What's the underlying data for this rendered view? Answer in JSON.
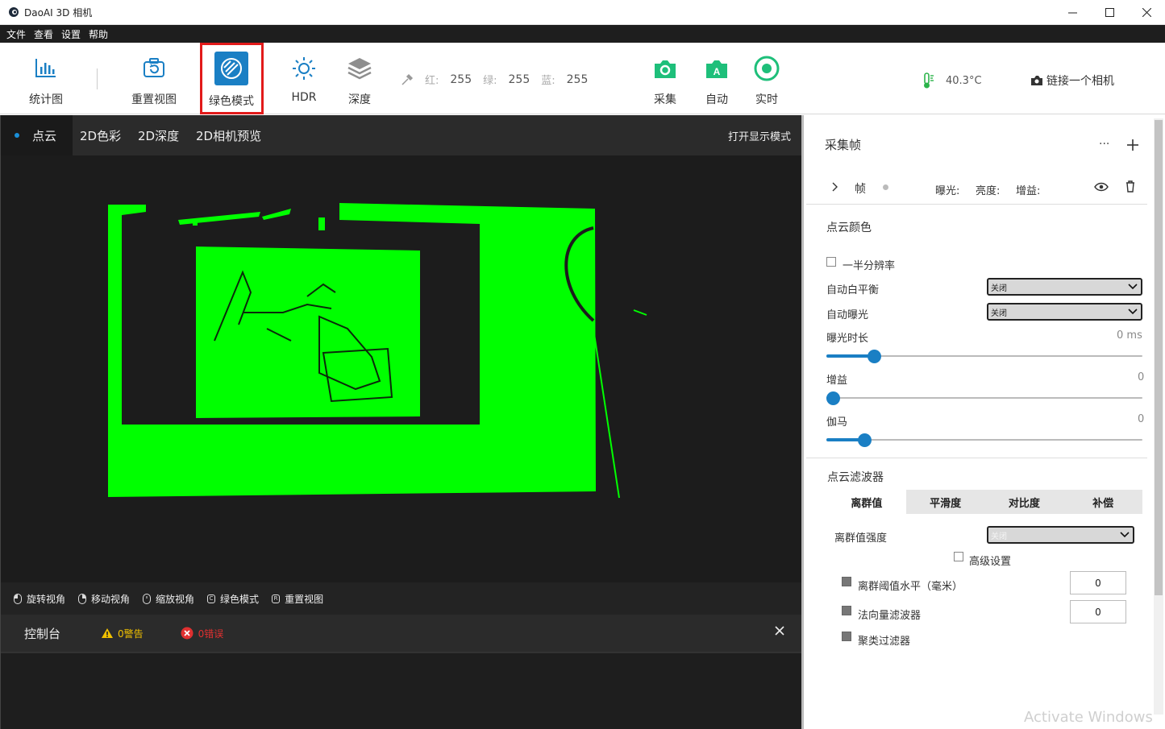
{
  "window": {
    "title": "DaoAI 3D 相机"
  },
  "menu": [
    "文件",
    "查看",
    "设置",
    "帮助"
  ],
  "toolbar": {
    "stats": "统计图",
    "reset_view": "重置视图",
    "green_mode": "绿色模式",
    "hdr": "HDR",
    "depth": "深度",
    "capture": "采集",
    "auto": "自动",
    "realtime": "实时",
    "rgb": {
      "r_label": "红:",
      "r": "255",
      "g_label": "绿:",
      "g": "255",
      "b_label": "蓝:",
      "b": "255"
    },
    "temperature": "40.3°C",
    "connect": "链接一个相机"
  },
  "viewer": {
    "tabs": [
      "点云",
      "2D色彩",
      "2D深度",
      "2D相机预览"
    ],
    "display_mode": "打开显示模式",
    "hints": [
      "旋转视角",
      "移动视角",
      "缩放视角",
      "绿色模式",
      "重置视图"
    ],
    "hint_keys": [
      "",
      "",
      "",
      "C",
      "R"
    ]
  },
  "console": {
    "title": "控制台",
    "warnings": "0警告",
    "errors": "0错误"
  },
  "panel": {
    "capture_frames": "采集帧",
    "more": "···",
    "frame": {
      "label": "帧",
      "exposure": "曝光:",
      "brightness": "亮度:",
      "gain": "增益:"
    },
    "pc_color": "点云颜色",
    "half_res": "一半分辨率",
    "auto_wb": {
      "label": "自动白平衡",
      "value": "关闭"
    },
    "auto_exp": {
      "label": "自动曝光",
      "value": "关闭"
    },
    "exposure_time": {
      "label": "曝光时长",
      "value": "0 ms",
      "level": 0.15
    },
    "gain": {
      "label": "增益",
      "value": "0",
      "level": 0.02
    },
    "gamma": {
      "label": "伽马",
      "value": "0",
      "level": 0.12
    },
    "filter_title": "点云滤波器",
    "filter_tabs": [
      "离群值",
      "平滑度",
      "对比度",
      "补偿"
    ],
    "outlier_strength": {
      "label": "离群值强度",
      "value": "关闭"
    },
    "advanced": "高级设置",
    "outlier_threshold": {
      "label": "离群阈值水平（毫米）",
      "value": "0"
    },
    "normal_filter": {
      "label": "法向量滤波器",
      "value": "0"
    },
    "cluster_filter": "聚类过滤器"
  },
  "watermark": "Activate Windows",
  "colors": {
    "accent": "#1a7fc4",
    "green": "#00ff00",
    "highlight": "#e21a1a",
    "capture_green": "#1ebf7a"
  }
}
